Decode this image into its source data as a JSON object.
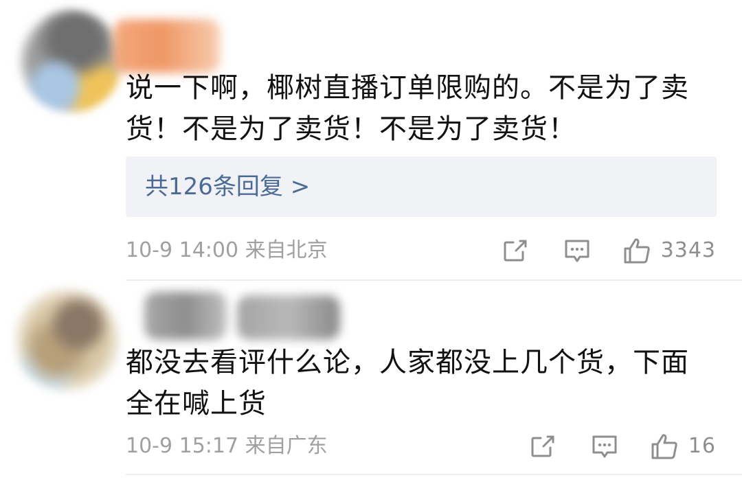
{
  "comments": [
    {
      "text": "说一下啊，椰树直播订单限购的。不是为了卖货！不是为了卖货！不是为了卖货！",
      "replies_label": "共126条回复 >",
      "timestamp": "10-9 14:00",
      "location": "来自北京",
      "like_count": "3343",
      "icons": [
        "share-icon",
        "comment-icon",
        "thumbs-up-icon"
      ]
    },
    {
      "text": "都没去看评什么论，人家都没上几个货，下面全在喊上货",
      "timestamp": "10-9 15:17",
      "location": "来自广东",
      "like_count": "16",
      "icons": [
        "share-icon",
        "comment-icon",
        "thumbs-up-icon"
      ]
    }
  ],
  "colors": {
    "link": "#4b6b95",
    "meta": "#a0a0a0",
    "icon": "#8e8e8e",
    "reply_box_bg": "#f1f2f5"
  }
}
